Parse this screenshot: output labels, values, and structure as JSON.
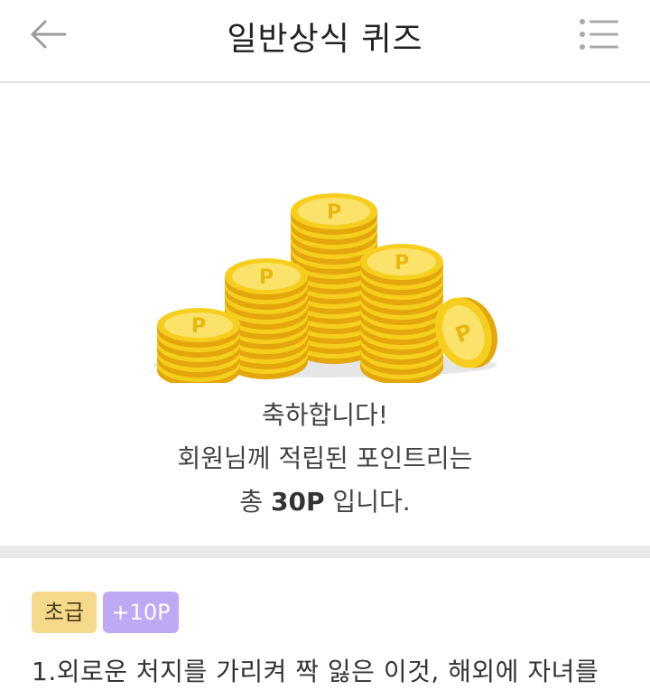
{
  "header": {
    "title": "일반상식 퀴즈",
    "back_icon": "arrow-left-icon",
    "menu_icon": "list-menu-icon"
  },
  "result": {
    "line1": "축하합니다!",
    "line2": "회원님께 적립된 포인트리는",
    "line3_prefix": "총 ",
    "line3_points": "30P",
    "line3_suffix": " 입니다."
  },
  "quiz": {
    "level_badge": "초급",
    "points_badge": "+10P",
    "question": "1.외로운 처지를 가리켜 짝 잃은 이것, 해외에 자녀를"
  },
  "colors": {
    "coin_gold": "#f6cf1e",
    "coin_light": "#fbe36b",
    "coin_shadow": "#e3a70c",
    "level_badge_bg": "#f7d98c",
    "points_badge_bg": "#bfa9f4"
  },
  "coin_symbol": "P"
}
